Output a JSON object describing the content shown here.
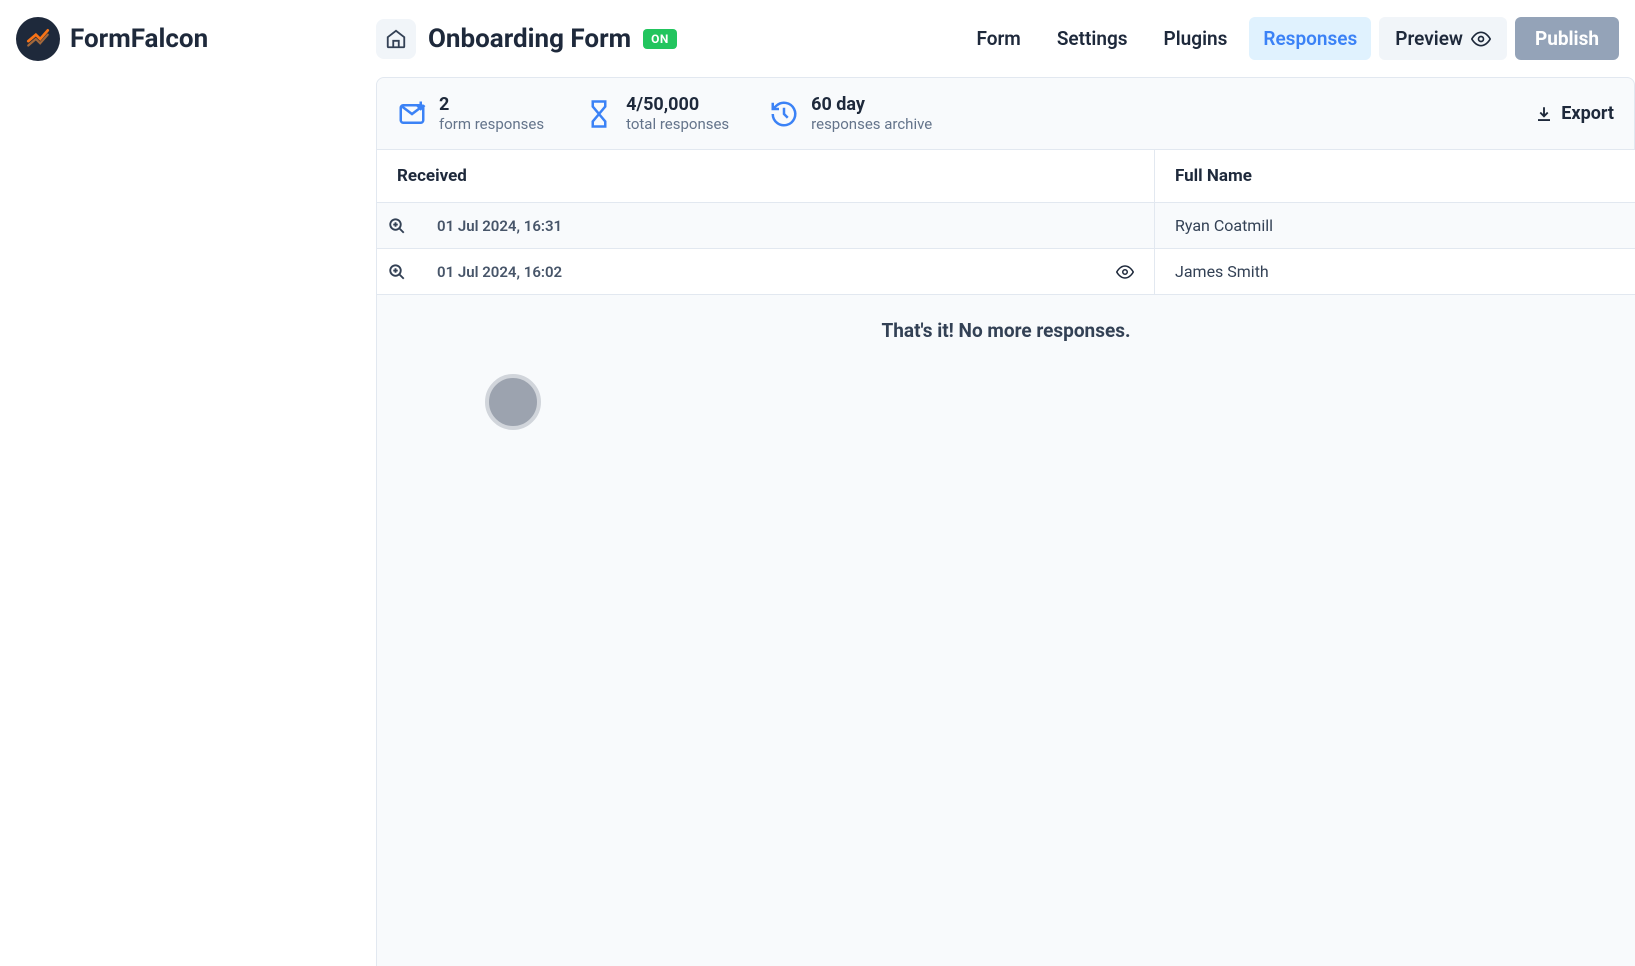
{
  "brand": {
    "name": "FormFalcon"
  },
  "header": {
    "title": "Onboarding Form",
    "status": "ON"
  },
  "nav": {
    "form": "Form",
    "settings": "Settings",
    "plugins": "Plugins",
    "responses": "Responses",
    "preview": "Preview",
    "publish": "Publish"
  },
  "stats": {
    "form_responses": {
      "value": "2",
      "label": "form responses"
    },
    "total_responses": {
      "value": "4/50,000",
      "label": "total responses"
    },
    "archive": {
      "value": "60 day",
      "label": "responses archive"
    },
    "export": "Export"
  },
  "table": {
    "headers": {
      "received": "Received",
      "full_name": "Full Name"
    },
    "rows": [
      {
        "received": "01 Jul 2024, 16:31",
        "full_name": "Ryan Coatmill",
        "eye": false
      },
      {
        "received": "01 Jul 2024, 16:02",
        "full_name": "James Smith",
        "eye": true
      }
    ],
    "empty_message": "That's it! No more responses."
  }
}
